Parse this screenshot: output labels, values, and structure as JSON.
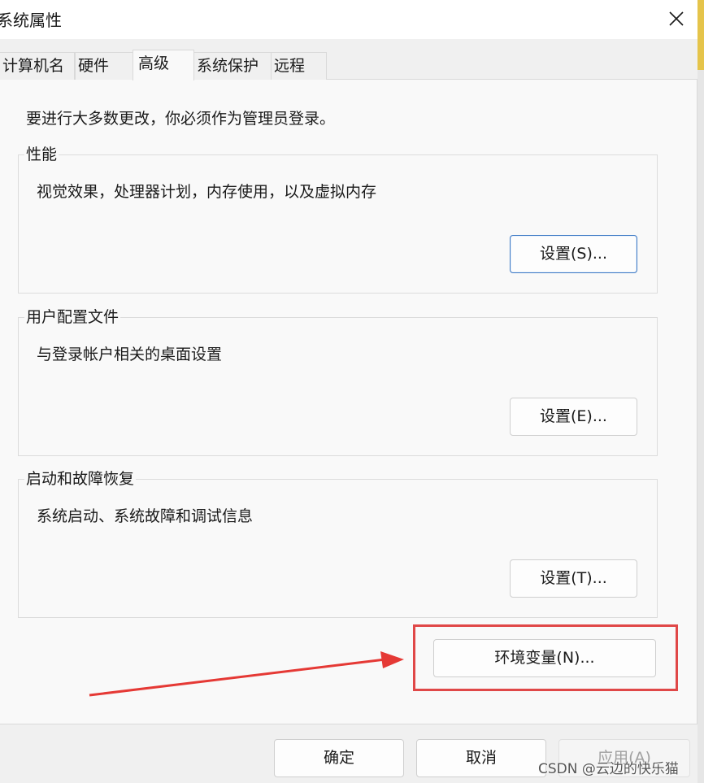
{
  "window": {
    "title": "系统属性",
    "close_icon": "close-icon"
  },
  "tabs": [
    {
      "label": "计算机名",
      "active": false
    },
    {
      "label": "硬件",
      "active": false
    },
    {
      "label": "高级",
      "active": true
    },
    {
      "label": "系统保护",
      "active": false
    },
    {
      "label": "远程",
      "active": false
    }
  ],
  "notice": "要进行大多数更改，你必须作为管理员登录。",
  "groups": {
    "performance": {
      "title": "性能",
      "description": "视觉效果，处理器计划，内存使用，以及虚拟内存",
      "button": "设置(S)..."
    },
    "user_profiles": {
      "title": "用户配置文件",
      "description": "与登录帐户相关的桌面设置",
      "button": "设置(E)..."
    },
    "startup_recovery": {
      "title": "启动和故障恢复",
      "description": "系统启动、系统故障和调试信息",
      "button": "设置(T)..."
    }
  },
  "env_button": "环境变量(N)...",
  "annotation": {
    "highlight_color": "#e04848"
  },
  "footer": {
    "ok": "确定",
    "cancel": "取消",
    "apply": "应用(A)"
  },
  "watermark": "CSDN @云边的快乐猫"
}
